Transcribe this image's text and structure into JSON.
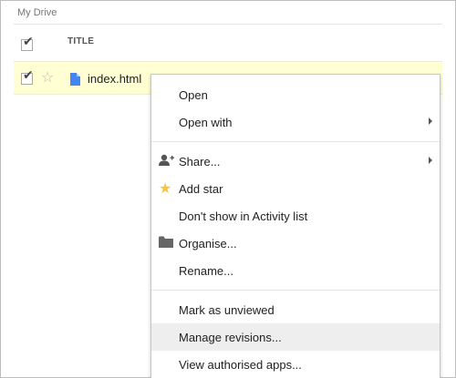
{
  "breadcrumb": "My Drive",
  "list": {
    "title_header": "TITLE",
    "file": {
      "name": "index.html",
      "selected": true,
      "starred": false
    }
  },
  "context_menu": {
    "open": "Open",
    "open_with": "Open with",
    "share": "Share...",
    "add_star": "Add star",
    "dont_show_activity": "Don't show in Activity list",
    "organise": "Organise...",
    "rename": "Rename...",
    "mark_unviewed": "Mark as unviewed",
    "manage_revisions": "Manage revisions...",
    "view_authorised_apps": "View authorised apps..."
  },
  "colors": {
    "selected_row": "#ffffd3",
    "doc_icon": "#4285f4",
    "star": "#f4c542",
    "hover_item": "#eeeeee"
  }
}
